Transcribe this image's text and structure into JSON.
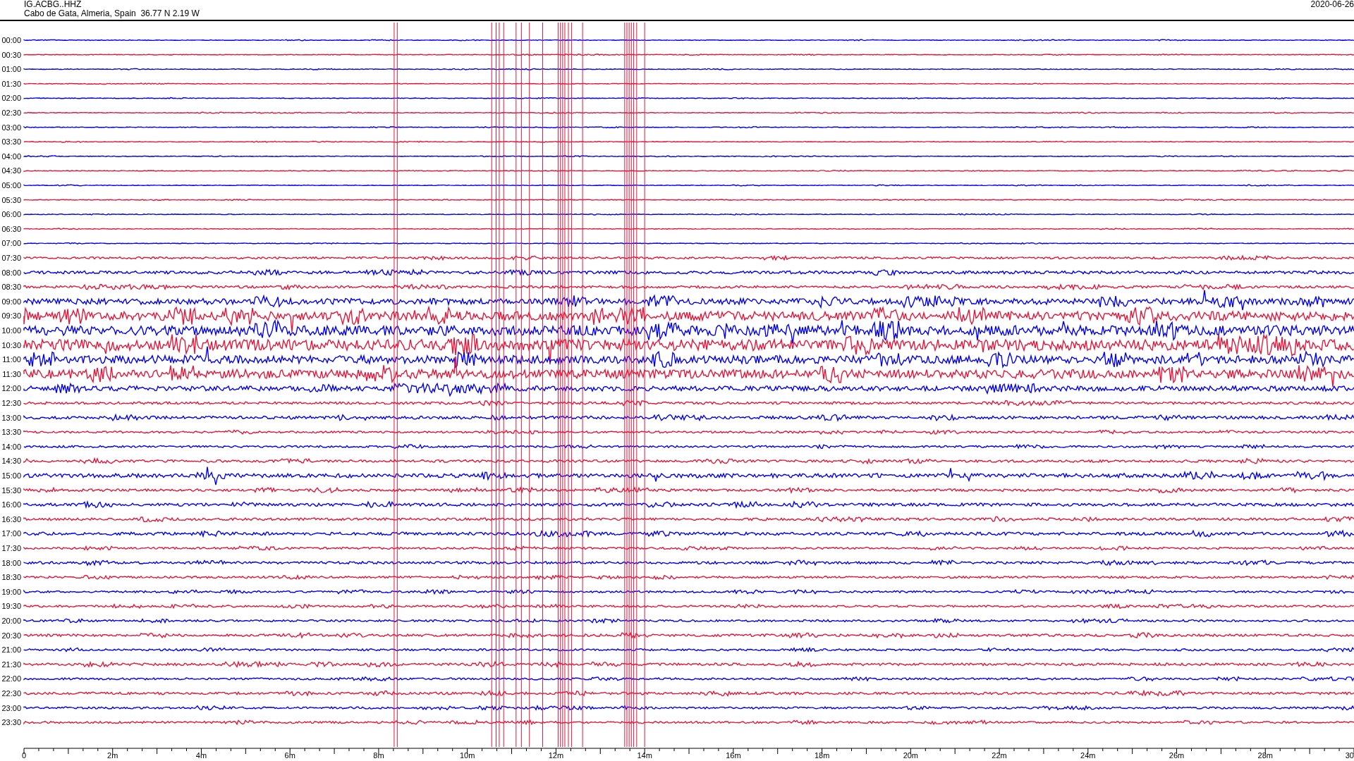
{
  "header": {
    "station": "IG.ACBG..HHZ",
    "location": "Cabo de Gata, Almeria, Spain  36.77 N 2.19 W",
    "date": "2020-06-26"
  },
  "traces": [
    {
      "time": "00:00",
      "color": "#0000ff"
    },
    {
      "time": "00:30",
      "color": "#e8173a"
    },
    {
      "time": "01:00",
      "color": "#0000ff"
    },
    {
      "time": "01:30",
      "color": "#e8173a"
    },
    {
      "time": "02:00",
      "color": "#0000ff"
    },
    {
      "time": "02:30",
      "color": "#e8173a"
    },
    {
      "time": "03:00",
      "color": "#0000ff"
    },
    {
      "time": "03:30",
      "color": "#e8173a"
    },
    {
      "time": "04:00",
      "color": "#0000ff"
    },
    {
      "time": "04:30",
      "color": "#e8173a"
    },
    {
      "time": "05:00",
      "color": "#0000ff"
    },
    {
      "time": "05:30",
      "color": "#e8173a"
    },
    {
      "time": "06:00",
      "color": "#0000ff"
    },
    {
      "time": "06:30",
      "color": "#e8173a"
    },
    {
      "time": "07:00",
      "color": "#0000ff"
    },
    {
      "time": "07:30",
      "color": "#e8173a"
    },
    {
      "time": "08:00",
      "color": "#0000ff"
    },
    {
      "time": "08:30",
      "color": "#e8173a"
    },
    {
      "time": "09:00",
      "color": "#0000ff"
    },
    {
      "time": "09:30",
      "color": "#e8173a"
    },
    {
      "time": "10:00",
      "color": "#0000ff"
    },
    {
      "time": "10:30",
      "color": "#e8173a"
    },
    {
      "time": "11:00",
      "color": "#0000ff"
    },
    {
      "time": "11:30",
      "color": "#e8173a"
    },
    {
      "time": "12:00",
      "color": "#0000ff"
    },
    {
      "time": "12:30",
      "color": "#e8173a"
    },
    {
      "time": "13:00",
      "color": "#0000ff"
    },
    {
      "time": "13:30",
      "color": "#e8173a"
    },
    {
      "time": "14:00",
      "color": "#0000ff"
    },
    {
      "time": "14:30",
      "color": "#e8173a"
    },
    {
      "time": "15:00",
      "color": "#0000ff"
    },
    {
      "time": "15:30",
      "color": "#e8173a"
    },
    {
      "time": "16:00",
      "color": "#0000ff"
    },
    {
      "time": "16:30",
      "color": "#e8173a"
    },
    {
      "time": "17:00",
      "color": "#0000ff"
    },
    {
      "time": "17:30",
      "color": "#e8173a"
    },
    {
      "time": "18:00",
      "color": "#0000ff"
    },
    {
      "time": "18:30",
      "color": "#e8173a"
    },
    {
      "time": "19:00",
      "color": "#0000ff"
    },
    {
      "time": "19:30",
      "color": "#e8173a"
    },
    {
      "time": "20:00",
      "color": "#0000ff"
    },
    {
      "time": "20:30",
      "color": "#e8173a"
    },
    {
      "time": "21:00",
      "color": "#0000ff"
    },
    {
      "time": "21:30",
      "color": "#e8173a"
    },
    {
      "time": "22:00",
      "color": "#0000ff"
    },
    {
      "time": "22:30",
      "color": "#e8173a"
    },
    {
      "time": "23:00",
      "color": "#0000ff"
    },
    {
      "time": "23:30",
      "color": "#e8173a"
    }
  ],
  "x_axis": {
    "ticks": [
      "0",
      "2m",
      "4m",
      "6m",
      "8m",
      "10m",
      "12m",
      "14m",
      "16m",
      "18m",
      "20m",
      "22m",
      "24m",
      "26m",
      "28m",
      "30"
    ]
  }
}
